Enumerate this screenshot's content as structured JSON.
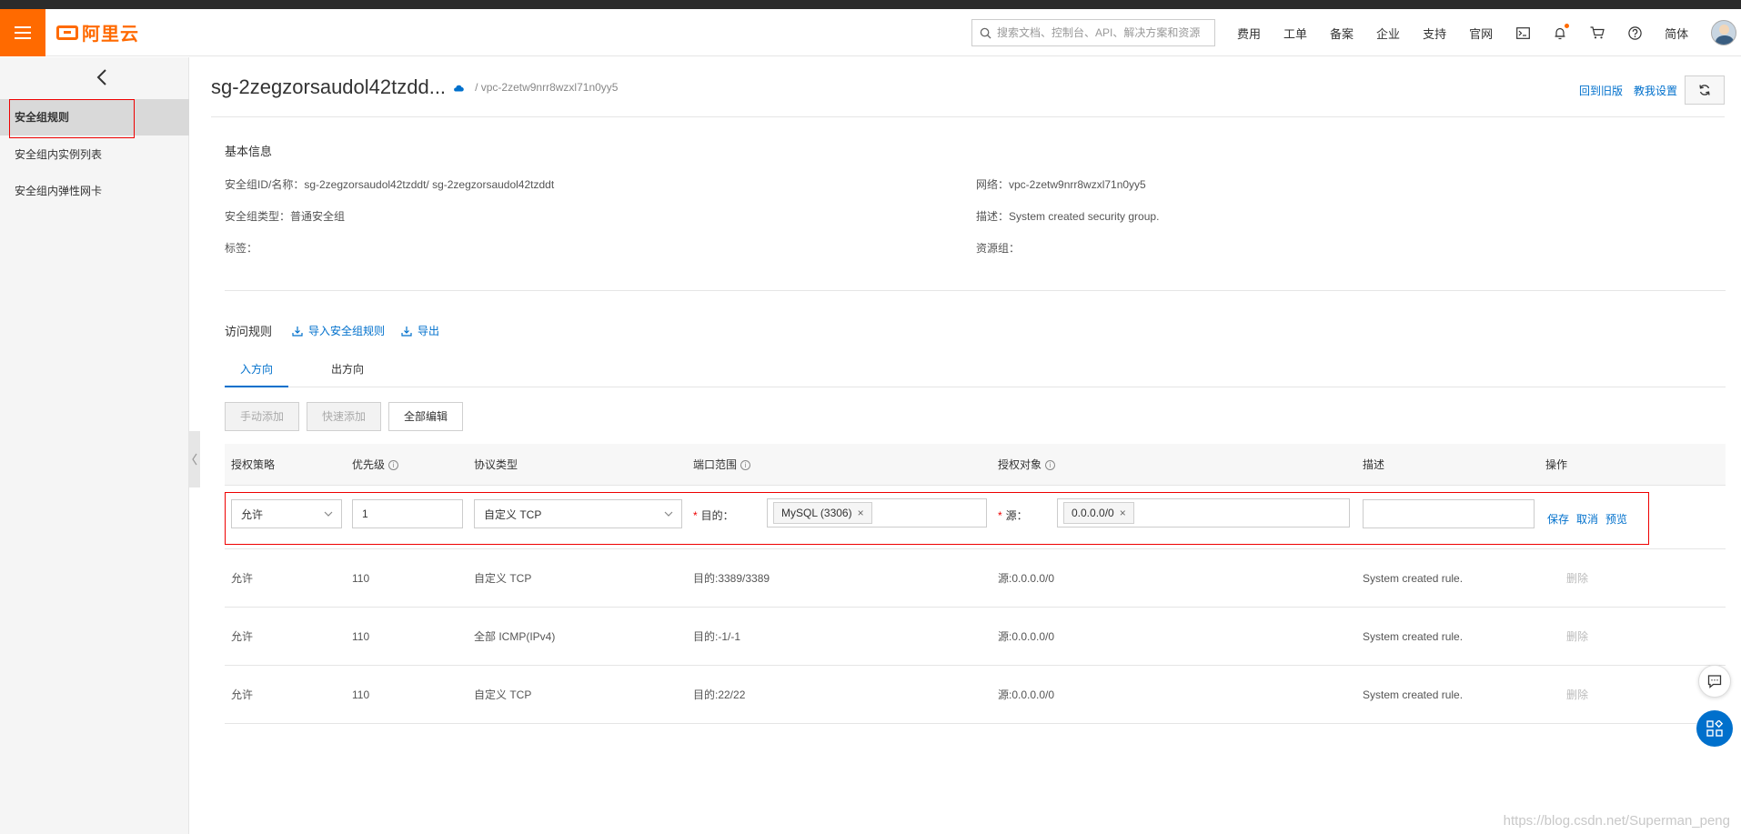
{
  "header": {
    "logo_text": "阿里云",
    "search_placeholder": "搜索文档、控制台、API、解决方案和资源",
    "nav": [
      "费用",
      "工单",
      "备案",
      "企业",
      "支持",
      "官网"
    ],
    "lang": "简体",
    "icons": [
      "terminal-icon",
      "bell-icon",
      "cart-icon",
      "help-icon"
    ]
  },
  "sidebar": {
    "items": [
      "安全组规则",
      "安全组内实例列表",
      "安全组内弹性网卡"
    ]
  },
  "page": {
    "title": "sg-2zegzorsaudol42tzdd...",
    "breadcrumb": "/ vpc-2zetw9nrr8wzxl71n0yy5",
    "back_old": "回到旧版",
    "tutorial": "教我设置"
  },
  "basic": {
    "title": "基本信息",
    "sg_id": "安全组ID/名称：sg-2zegzorsaudol42tzddt/ sg-2zegzorsaudol42tzddt",
    "sg_type": "安全组类型：普通安全组",
    "tags": "标签：",
    "network": "网络：vpc-2zetw9nrr8wzxl71n0yy5",
    "desc": "描述：System created security group.",
    "resource_group": "资源组："
  },
  "rules": {
    "title": "访问规则",
    "import": "导入安全组规则",
    "export": "导出",
    "tabs": [
      "入方向",
      "出方向"
    ],
    "buttons": [
      "手动添加",
      "快速添加",
      "全部编辑"
    ],
    "columns": [
      "授权策略",
      "优先级",
      "协议类型",
      "端口范围",
      "授权对象",
      "描述",
      "操作"
    ],
    "edit": {
      "policy": "允许",
      "priority": "1",
      "protocol": "自定义 TCP",
      "dest_label": "目的：",
      "dest_tag": "MySQL (3306)",
      "source_label": "源：",
      "source_tag": "0.0.0.0/0",
      "desc": "",
      "save": "保存",
      "cancel": "取消",
      "preview": "预览"
    },
    "rows": [
      {
        "policy": "允许",
        "priority": "110",
        "protocol": "自定义 TCP",
        "port": "目的:3389/3389",
        "source": "源:0.0.0.0/0",
        "desc": "System created rule.",
        "op": "删除"
      },
      {
        "policy": "允许",
        "priority": "110",
        "protocol": "全部 ICMP(IPv4)",
        "port": "目的:-1/-1",
        "source": "源:0.0.0.0/0",
        "desc": "System created rule.",
        "op": "删除"
      },
      {
        "policy": "允许",
        "priority": "110",
        "protocol": "自定义 TCP",
        "port": "目的:22/22",
        "source": "源:0.0.0.0/0",
        "desc": "System created rule.",
        "op": "删除"
      }
    ]
  },
  "watermark": "https://blog.csdn.net/Superman_peng",
  "colors": {
    "brand": "#ff6a00",
    "link": "#0070cc",
    "highlight": "#e00000"
  }
}
